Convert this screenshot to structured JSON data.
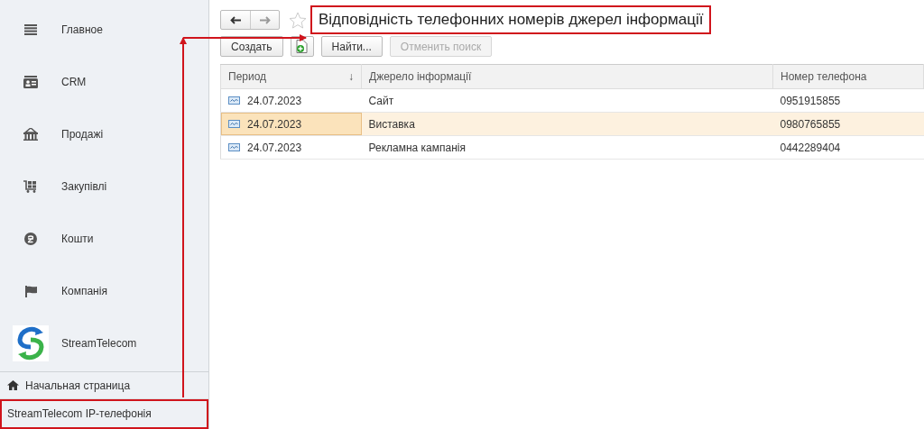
{
  "sidebar": {
    "items": [
      {
        "label": "Главное"
      },
      {
        "label": "CRM"
      },
      {
        "label": "Продажі"
      },
      {
        "label": "Закупівлі"
      },
      {
        "label": "Кошти"
      },
      {
        "label": "Компанія"
      },
      {
        "label": "StreamTelecom"
      }
    ],
    "footer_items": [
      {
        "label": "Начальная страница",
        "kind": "home",
        "annotated": false
      },
      {
        "label": "StreamTelecom IP-телефонія",
        "kind": "plain",
        "annotated": true
      }
    ]
  },
  "header": {
    "back_disabled": false,
    "forward_disabled": true,
    "favorite": false,
    "title": "Відповідність телефонних номерів джерел інформації",
    "title_annotated": true
  },
  "toolbar": [
    {
      "kind": "text",
      "label": "Создать",
      "disabled": false
    },
    {
      "kind": "icon",
      "disabled": false
    },
    {
      "kind": "text",
      "label": "Найти...",
      "disabled": false
    },
    {
      "kind": "text",
      "label": "Отменить поиск",
      "disabled": true
    }
  ],
  "table": {
    "columns": [
      {
        "label": "Период",
        "sort": "↓"
      },
      {
        "label": "Джерело інформації"
      },
      {
        "label": "Номер телефона"
      }
    ],
    "rows": [
      {
        "cells": [
          "24.07.2023",
          "Сайт",
          "0951915855"
        ],
        "selected": false
      },
      {
        "cells": [
          "24.07.2023",
          "Виставка",
          "0980765855"
        ],
        "selected": true
      },
      {
        "cells": [
          "24.07.2023",
          "Рекламна кампанія",
          "0442289404"
        ],
        "selected": false
      }
    ]
  }
}
